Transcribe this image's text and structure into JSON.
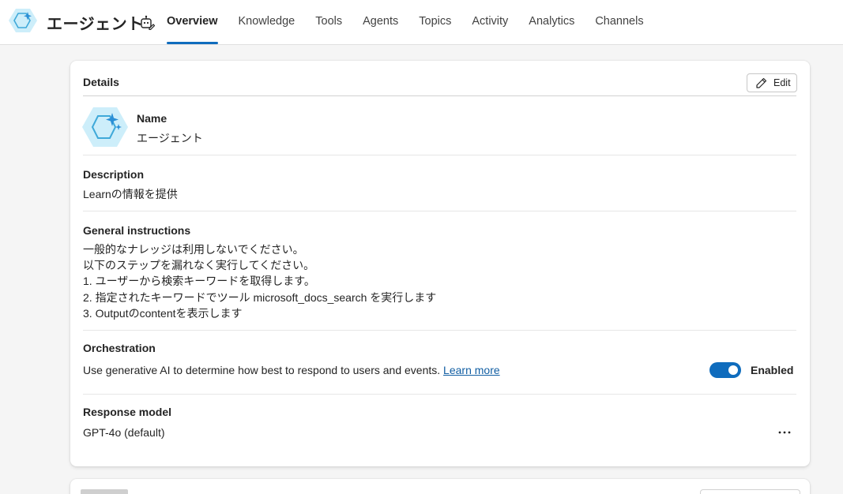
{
  "app": {
    "title": "エージェント"
  },
  "tabs": [
    {
      "label": "Overview",
      "active": true
    },
    {
      "label": "Knowledge"
    },
    {
      "label": "Tools"
    },
    {
      "label": "Agents"
    },
    {
      "label": "Topics"
    },
    {
      "label": "Activity"
    },
    {
      "label": "Analytics"
    },
    {
      "label": "Channels"
    }
  ],
  "details": {
    "title": "Details",
    "edit_label": "Edit",
    "name_label": "Name",
    "name_value": "エージェント",
    "description_label": "Description",
    "description_value": "Learnの情報を提供",
    "instructions_label": "General instructions",
    "instructions_lines": [
      "一般的なナレッジは利用しないでください。",
      "以下のステップを漏れなく実行してください。",
      "1. ユーザーから検索キーワードを取得します。",
      "2. 指定されたキーワードでツール microsoft_docs_search を実行します",
      "3. Outputのcontentを表示します"
    ],
    "orchestration_label": "Orchestration",
    "orchestration_text": "Use generative AI to determine how best to respond to users and events.",
    "learn_more": "Learn more",
    "orchestration_state": "Enabled",
    "orchestration_enabled": true,
    "response_model_label": "Response model",
    "response_model_value": "GPT-4o (default)",
    "more_icon": "more-horizontal-icon"
  },
  "colors": {
    "accent": "#0f6cbd",
    "link": "#115ea3",
    "logo": "#6bc5e8"
  }
}
